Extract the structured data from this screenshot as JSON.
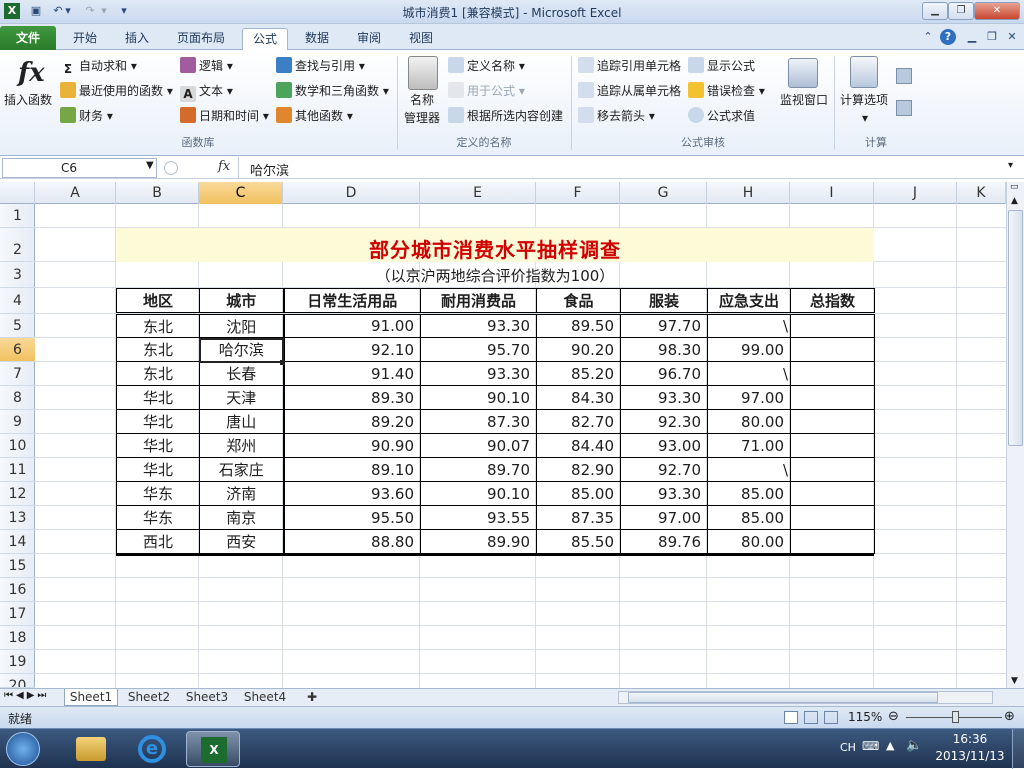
{
  "window": {
    "title": "城市消费1  [兼容模式]  -  Microsoft Excel",
    "qat_undo_icon": "undo-icon",
    "qat_save_icon": "save-icon"
  },
  "tabs": [
    "文件",
    "开始",
    "插入",
    "页面布局",
    "公式",
    "数据",
    "审阅",
    "视图"
  ],
  "ribbon": {
    "insert_function": "插入函数",
    "autosum": "自动求和",
    "recent": "最近使用的函数",
    "finance": "财务",
    "logic": "逻辑",
    "text": "文本",
    "datetime": "日期和时间",
    "lookup": "查找与引用",
    "math": "数学和三角函数",
    "other": "其他函数",
    "group_lib": "函数库",
    "name_mgr_1": "名称",
    "name_mgr_2": "管理器",
    "define_name": "定义名称",
    "use_in_formula": "用于公式",
    "create_from_sel": "根据所选内容创建",
    "group_names": "定义的名称",
    "trace_precedents": "追踪引用单元格",
    "trace_dependents": "追踪从属单元格",
    "remove_arrows": "移去箭头",
    "show_formulas": "显示公式",
    "error_check": "错误检查",
    "evaluate": "公式求值",
    "watch": "监视窗口",
    "group_audit": "公式审核",
    "calc_options": "计算选项",
    "group_calc": "计算"
  },
  "formula_bar": {
    "name_box": "C6",
    "fx": "fx",
    "value": "哈尔滨"
  },
  "columns": [
    "A",
    "B",
    "C",
    "D",
    "E",
    "F",
    "G",
    "H",
    "I",
    "J",
    "K"
  ],
  "rows": [
    "1",
    "2",
    "3",
    "4",
    "5",
    "6",
    "7",
    "8",
    "9",
    "10",
    "11",
    "12",
    "13",
    "14",
    "15",
    "16",
    "17",
    "18",
    "19",
    "20"
  ],
  "sheet": {
    "title": "部分城市消费水平抽样调查",
    "subtitle": "（以京沪两地综合评价指数为100）",
    "headers": [
      "地区",
      "城市",
      "日常生活用品",
      "耐用消费品",
      "食品",
      "服装",
      "应急支出",
      "总指数"
    ],
    "rows": [
      [
        "东北",
        "沈阳",
        "91.00",
        "93.30",
        "89.50",
        "97.70",
        "\\",
        ""
      ],
      [
        "东北",
        "哈尔滨",
        "92.10",
        "95.70",
        "90.20",
        "98.30",
        "99.00",
        ""
      ],
      [
        "东北",
        "长春",
        "91.40",
        "93.30",
        "85.20",
        "96.70",
        "\\",
        ""
      ],
      [
        "华北",
        "天津",
        "89.30",
        "90.10",
        "84.30",
        "93.30",
        "97.00",
        ""
      ],
      [
        "华北",
        "唐山",
        "89.20",
        "87.30",
        "82.70",
        "92.30",
        "80.00",
        ""
      ],
      [
        "华北",
        "郑州",
        "90.90",
        "90.07",
        "84.40",
        "93.00",
        "71.00",
        ""
      ],
      [
        "华北",
        "石家庄",
        "89.10",
        "89.70",
        "82.90",
        "92.70",
        "\\",
        ""
      ],
      [
        "华东",
        "济南",
        "93.60",
        "90.10",
        "85.00",
        "93.30",
        "85.00",
        ""
      ],
      [
        "华东",
        "南京",
        "95.50",
        "93.55",
        "87.35",
        "97.00",
        "85.00",
        ""
      ],
      [
        "西北",
        "西安",
        "88.80",
        "89.90",
        "85.50",
        "89.76",
        "80.00",
        ""
      ]
    ]
  },
  "sheet_tabs": [
    "Sheet1",
    "Sheet2",
    "Sheet3",
    "Sheet4"
  ],
  "status": {
    "ready": "就绪",
    "zoom": "115%"
  },
  "taskbar": {
    "ime": "CH",
    "time": "16:36",
    "date": "2013/11/13"
  },
  "colors": {
    "title_red": "#d00000",
    "title_band": "#fdfbd7",
    "file_tab": "#2b7b2b",
    "selected_header": "#f1c15f"
  }
}
